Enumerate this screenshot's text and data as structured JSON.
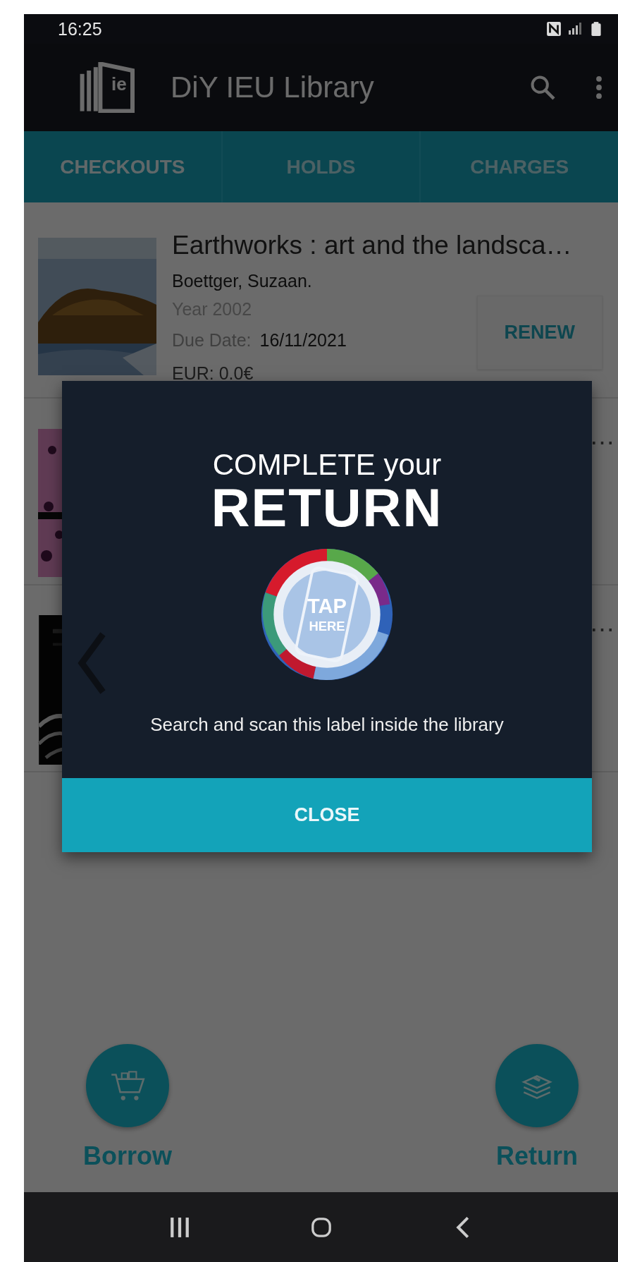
{
  "status_bar": {
    "time": "16:25"
  },
  "app_bar": {
    "logo_text": "ie",
    "title": "DiY IEU Library"
  },
  "tabs": [
    {
      "label": "CHECKOUTS",
      "selected": true
    },
    {
      "label": "HOLDS",
      "selected": false
    },
    {
      "label": "CHARGES",
      "selected": false
    }
  ],
  "checkouts": [
    {
      "title": "Earthworks : art and the landsca…",
      "author": "Boettger, Suzaan.",
      "year": "Year 2002",
      "due_label": "Due Date:",
      "due_date": "16/11/2021",
      "charge": "EUR: 0.0€",
      "action": "RENEW"
    },
    {
      "title": "…"
    },
    {
      "title": "…"
    }
  ],
  "actions": [
    {
      "kind": "borrow",
      "label": "Borrow"
    },
    {
      "kind": "return",
      "label": "Return"
    }
  ],
  "dialog": {
    "heading_1": "COMPLETE your",
    "heading_2": "RETURN",
    "badge_lines": [
      "TAP",
      "HERE"
    ],
    "message": "Search and scan this label inside the library",
    "button": "CLOSE"
  }
}
